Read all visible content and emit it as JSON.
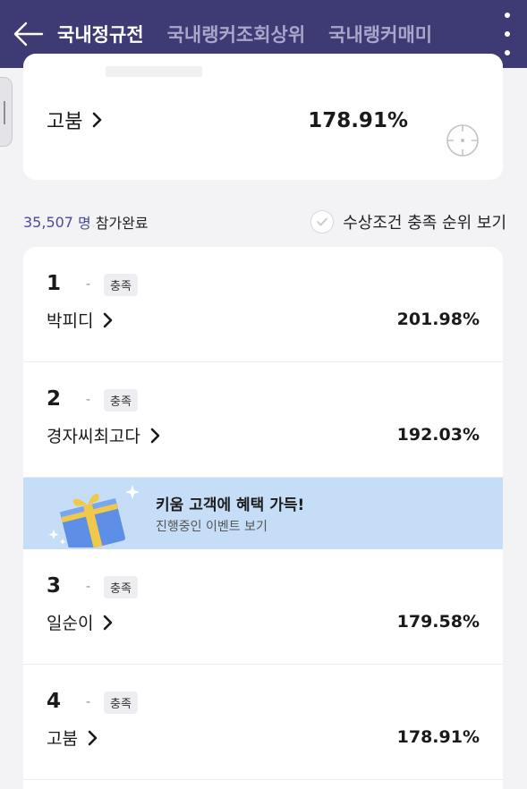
{
  "header": {
    "tabs": [
      {
        "label": "국내정규전",
        "active": true
      },
      {
        "label": "국내랭커조회상위",
        "active": false
      },
      {
        "label": "국내랭커매미",
        "active": false
      }
    ],
    "back_icon": "arrow-left-icon",
    "more_icon": "kebab-menu-icon"
  },
  "my_entry": {
    "name": "고붐",
    "rate": "178.91%"
  },
  "participants": {
    "count": "35,507",
    "unit": "명",
    "label": "참가완료"
  },
  "filter": {
    "label": "수상조건 충족 순위 보기",
    "checked": false
  },
  "rankings": [
    {
      "rank": "1",
      "change": "-",
      "badge": "충족",
      "name": "박피디",
      "rate": "201.98%"
    },
    {
      "rank": "2",
      "change": "-",
      "badge": "충족",
      "name": "경자씨최고다",
      "rate": "192.03%"
    },
    {
      "rank": "3",
      "change": "-",
      "badge": "충족",
      "name": "일순이",
      "rate": "179.58%"
    },
    {
      "rank": "4",
      "change": "-",
      "badge": "충족",
      "name": "고붐",
      "rate": "178.91%"
    }
  ],
  "banner": {
    "title": "키움 고객에 혜택 가득!",
    "subtitle": "진행중인 이벤트 보기"
  },
  "colors": {
    "header_bg": "#3d3a74",
    "accent": "#4a4a9c",
    "banner_bg": "#c6ddf7",
    "page_bg": "#f3f3f6"
  }
}
